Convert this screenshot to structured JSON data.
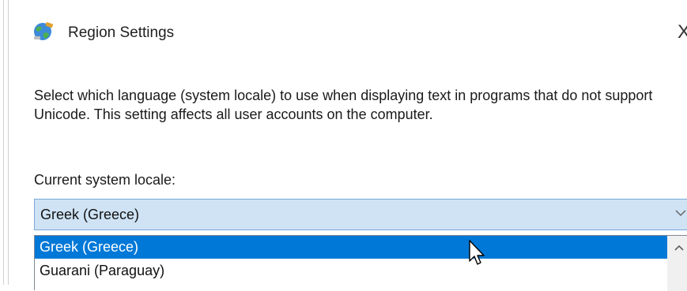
{
  "window": {
    "title": "Region Settings",
    "close_glyph": "X",
    "icon": "globe-settings-icon"
  },
  "description": "Select which language (system locale) to use when displaying text in programs that do not support Unicode. This setting affects all user accounts on the computer.",
  "locale": {
    "label": "Current system locale:",
    "selected_value": "Greek (Greece)",
    "options": [
      {
        "label": "Greek (Greece)",
        "highlighted": true
      },
      {
        "label": "Guarani (Paraguay)",
        "highlighted": false
      }
    ]
  },
  "colors": {
    "selection_blue": "#0078d7",
    "select_bg": "#cfe3f5",
    "select_border": "#7aa7d9"
  }
}
